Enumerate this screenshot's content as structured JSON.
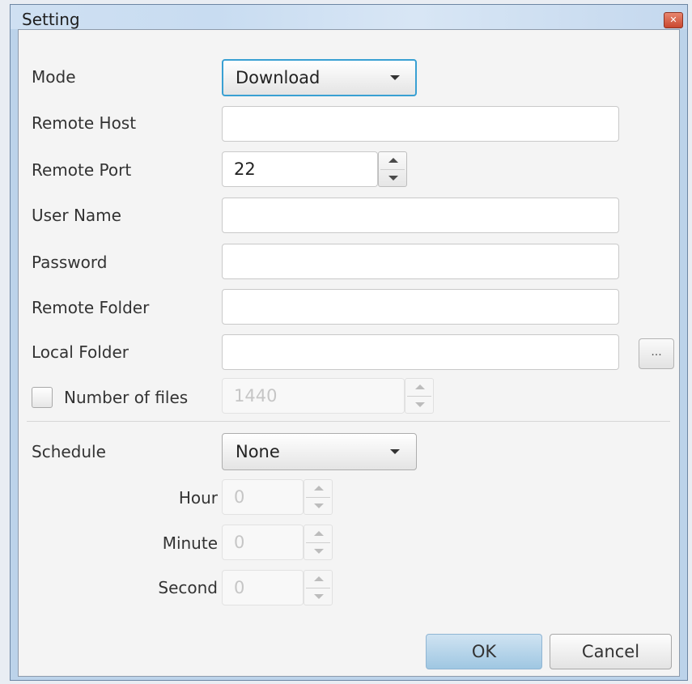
{
  "window": {
    "title": "Setting"
  },
  "form": {
    "mode": {
      "label": "Mode",
      "value": "Download"
    },
    "remote_host": {
      "label": "Remote Host",
      "value": ""
    },
    "remote_port": {
      "label": "Remote Port",
      "value": "22"
    },
    "user_name": {
      "label": "User Name",
      "value": ""
    },
    "password": {
      "label": "Password",
      "value": ""
    },
    "remote_folder": {
      "label": "Remote Folder",
      "value": ""
    },
    "local_folder": {
      "label": "Local Folder",
      "value": "",
      "browse_label": "..."
    },
    "number_of_files": {
      "label": "Number of files",
      "checked": false,
      "value": "1440",
      "enabled": false
    },
    "schedule": {
      "label": "Schedule",
      "value": "None",
      "hour": {
        "label": "Hour",
        "value": "0"
      },
      "minute": {
        "label": "Minute",
        "value": "0"
      },
      "second": {
        "label": "Second",
        "value": "0"
      }
    }
  },
  "buttons": {
    "ok": "OK",
    "cancel": "Cancel"
  },
  "colors": {
    "focus_accent": "#39a0d3",
    "ok_button": "#b7d6ec",
    "close_button": "#d9573d"
  }
}
